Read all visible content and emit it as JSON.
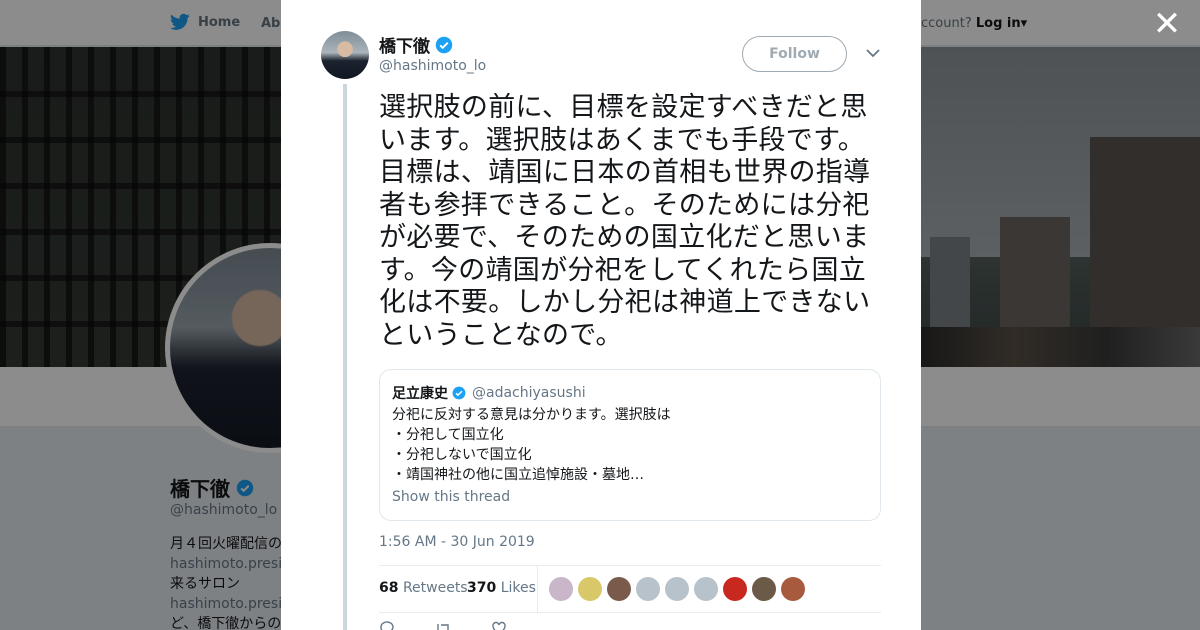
{
  "nav": {
    "home_label": "Home",
    "about_label": "Abo",
    "account_prompt": "ccount?",
    "login_label": "Log in"
  },
  "profile": {
    "name": "橋下徹",
    "handle": "@hashimoto_lo",
    "bio_lines": [
      {
        "text": "月４回火曜配信の",
        "style": "normal"
      },
      {
        "text": "hashimoto.preside",
        "style": "link"
      },
      {
        "text": "来るサロン",
        "style": "normal"
      },
      {
        "text": "hashimoto.preside",
        "style": "link"
      },
      {
        "text": "ど、橋下徹からの",
        "style": "normal"
      }
    ]
  },
  "modal": {
    "close_label": "✕",
    "author": {
      "name": "橋下徹",
      "handle": "@hashimoto_lo"
    },
    "follow_label": "Follow",
    "tweet_text": "選択肢の前に、目標を設定すべきだと思います。選択肢はあくまでも手段です。目標は、靖国に日本の首相も世界の指導者も参拝できること。そのためには分祀が必要で、そのための国立化だと思います。今の靖国が分祀をしてくれたら国立化は不要。しかし分祀は神道上できないということなので。",
    "quote": {
      "name": "足立康史",
      "handle": "@adachiyasushi",
      "lines": [
        "分祀に反対する意見は分かります。選択肢は",
        "・分祀して国立化",
        "・分祀しないで国立化",
        "・靖国神社の他に国立追悼施設・墓地…"
      ],
      "show_thread": "Show this thread"
    },
    "timestamp": "1:56 AM - 30 Jun 2019",
    "retweets_count": "68",
    "retweets_label": "Retweets",
    "likes_count": "370",
    "likes_label": "Likes",
    "liker_colors": [
      "#c9b6c9",
      "#d8c86a",
      "#7a5a4a",
      "#b8c2ca",
      "#b8c2ca",
      "#b8c2ca",
      "#c8281e",
      "#6b5a48",
      "#a85a3e"
    ]
  },
  "colors": {
    "twitter_blue": "#1da1f2",
    "text": "#14171a",
    "secondary": "#657786"
  }
}
